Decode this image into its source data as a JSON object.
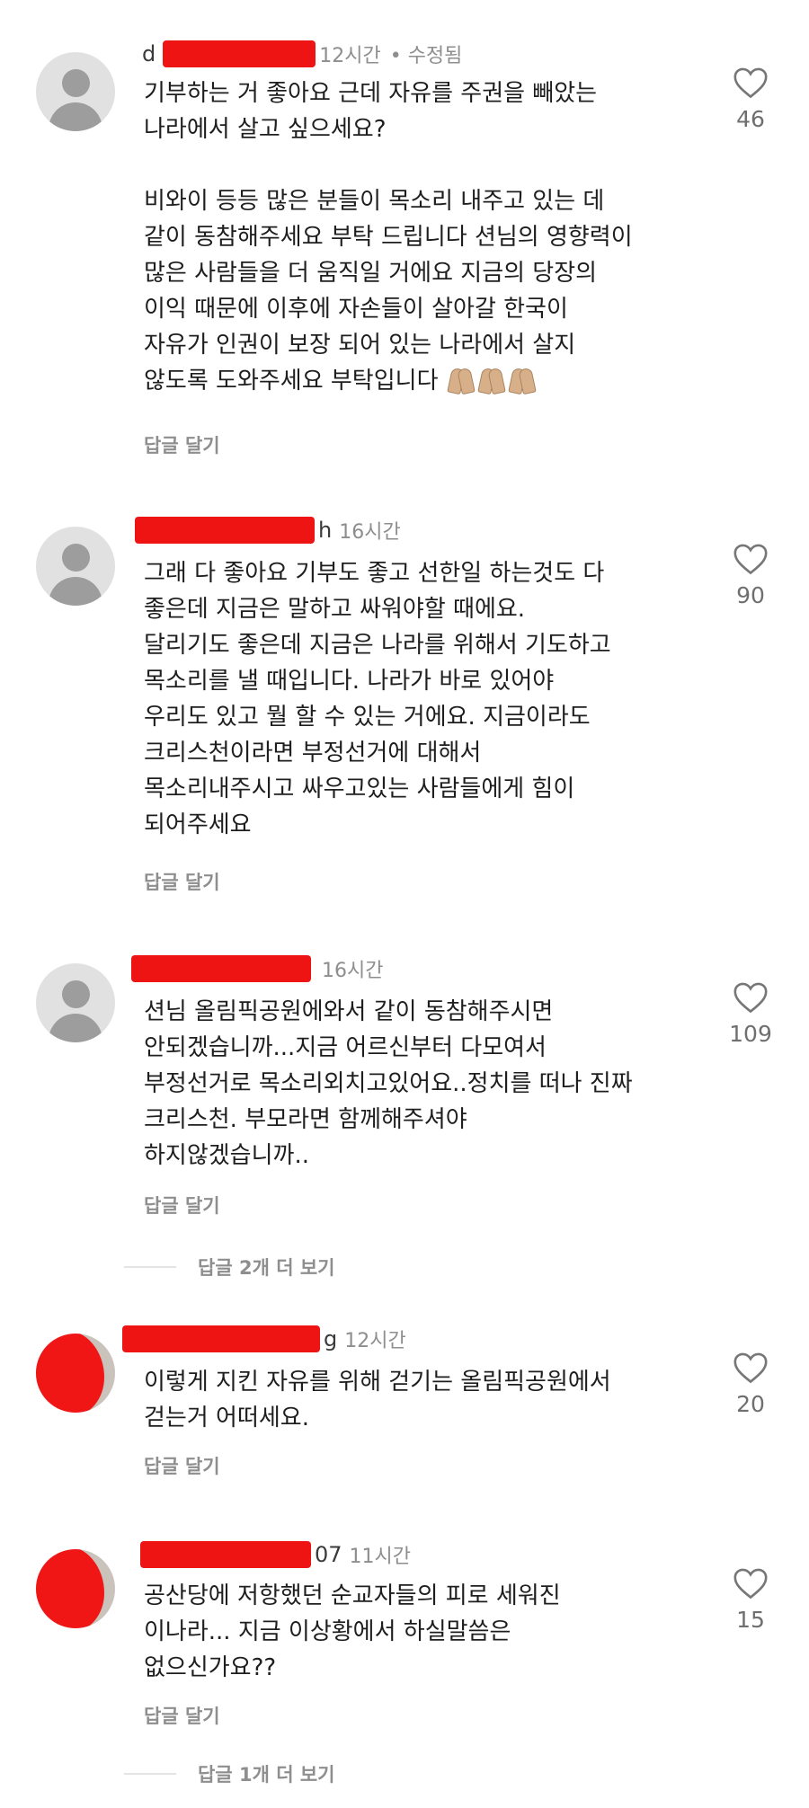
{
  "comments": [
    {
      "name_visible": "d",
      "time": "12시간",
      "edited": "• 수정됨",
      "lines": [
        "기부하는 거 좋아요 근데 자유를 주권을 빼았는",
        "나라에서 살고 싶으세요?",
        "",
        "비와이 등등 많은 분들이 목소리 내주고 있는 데",
        "같이 동참해주세요 부탁 드립니다 션님의 영향력이",
        "많은 사람들을 더 움직일 거에요 지금의 당장의",
        "이익 때문에 이후에 자손들이 살아갈 한국이",
        "자유가 인권이 보장 되어 있는 나라에서 살지",
        "않도록 도와주세요 부탁입니다"
      ],
      "emoji": "🙏🏼🙏🏼🙏🏼",
      "reply": "답글 달기",
      "likes": "46"
    },
    {
      "name_visible": "h",
      "time": "16시간",
      "lines": [
        "그래 다 좋아요 기부도 좋고 선한일 하는것도 다",
        "좋은데 지금은 말하고 싸워야할 때에요.",
        "달리기도 좋은데 지금은 나라를 위해서 기도하고",
        "목소리를 낼 때입니다. 나라가 바로 있어야",
        "우리도 있고 뭘 할 수 있는 거에요. 지금이라도",
        "크리스천이라면 부정선거에 대해서",
        "목소리내주시고 싸우고있는 사람들에게 힘이",
        "되어주세요"
      ],
      "reply": "답글 달기",
      "likes": "90"
    },
    {
      "name_visible": "",
      "time": "16시간",
      "lines": [
        "션님 올림픽공원에와서 같이 동참해주시면",
        "안되겠습니까...지금 어르신부터 다모여서",
        "부정선거로 목소리외치고있어요..정치를 떠나 진짜",
        "크리스천. 부모라면 함께해주셔야",
        "하지않겠습니까.."
      ],
      "reply": "답글 달기",
      "likes": "109",
      "more_replies": "답글 2개 더 보기"
    },
    {
      "name_visible": "g",
      "time": "12시간",
      "lines": [
        "이렇게 지킨 자유를 위해 걷기는 올림픽공원에서",
        "걷는거 어떠세요."
      ],
      "reply": "답글 달기",
      "likes": "20"
    },
    {
      "name_visible": "07",
      "time": "11시간",
      "lines": [
        "공산당에 저항했던 순교자들의 피로 세워진",
        "이나라... 지금 이상황에서 하실말씀은",
        "없으신가요??"
      ],
      "reply": "답글 달기",
      "likes": "15",
      "more_replies": "답글 1개 더 보기"
    }
  ]
}
